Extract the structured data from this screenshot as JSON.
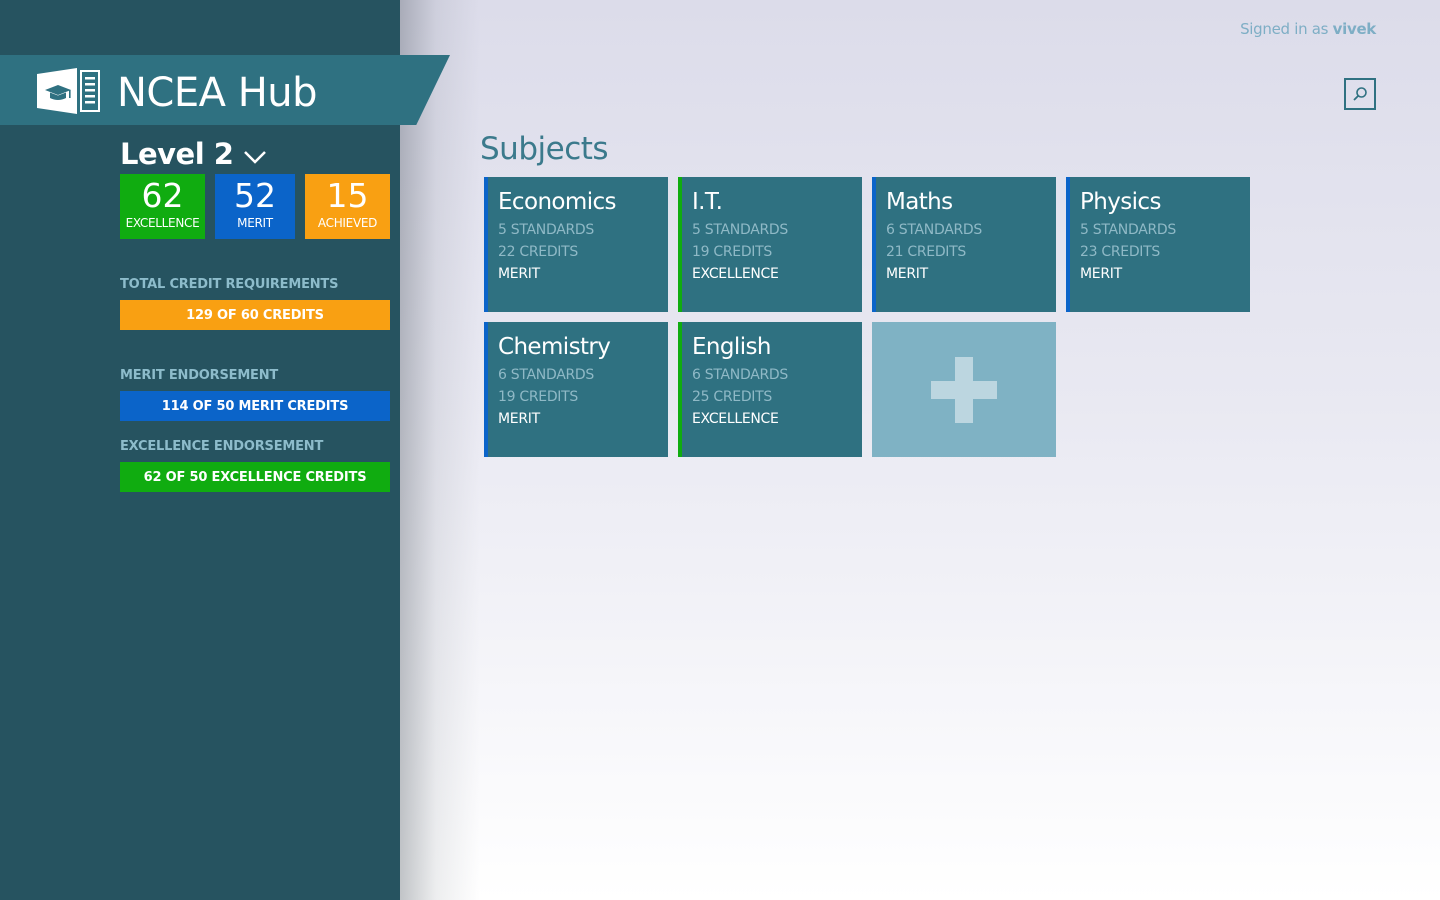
{
  "app": {
    "title": "NCEA Hub"
  },
  "header": {
    "signed_in_prefix": "Signed in as",
    "username": "vivek"
  },
  "level": {
    "label": "Level 2"
  },
  "stats": [
    {
      "value": "62",
      "label": "EXCELLENCE",
      "color": "#10ac10"
    },
    {
      "value": "52",
      "label": "MERIT",
      "color": "#0b64c9"
    },
    {
      "value": "15",
      "label": "ACHIEVED",
      "color": "#f9a012"
    }
  ],
  "requirements": [
    {
      "heading": "TOTAL CREDIT REQUIREMENTS",
      "text": "129 OF 60 CREDITS",
      "color": "#f9a012"
    },
    {
      "heading": "MERIT ENDORSEMENT",
      "text": "114 OF 50 MERIT CREDITS",
      "color": "#0b64c9"
    },
    {
      "heading": "EXCELLENCE ENDORSEMENT",
      "text": "62 OF 50 EXCELLENCE CREDITS",
      "color": "#10ac10"
    }
  ],
  "main": {
    "heading": "Subjects",
    "subjects": [
      {
        "name": "Economics",
        "standards": "5 STANDARDS",
        "credits": "22 CREDITS",
        "grade": "MERIT"
      },
      {
        "name": "I.T.",
        "standards": "5 STANDARDS",
        "credits": "19 CREDITS",
        "grade": "EXCELLENCE"
      },
      {
        "name": "Maths",
        "standards": "6 STANDARDS",
        "credits": "21 CREDITS",
        "grade": "MERIT"
      },
      {
        "name": "Physics",
        "standards": "5 STANDARDS",
        "credits": "23 CREDITS",
        "grade": "MERIT"
      },
      {
        "name": "Chemistry",
        "standards": "6 STANDARDS",
        "credits": "19 CREDITS",
        "grade": "MERIT"
      },
      {
        "name": "English",
        "standards": "6 STANDARDS",
        "credits": "25 CREDITS",
        "grade": "EXCELLENCE"
      }
    ]
  },
  "icons": {
    "logo": "graduation-cap-document-icon",
    "level_dropdown": "chevron-down-icon",
    "search": "search-icon",
    "add": "plus-icon"
  },
  "colors": {
    "sidebar": "#265360",
    "tile": "#2f7181",
    "add_tile": "#7fb2c4",
    "excellence": "#10ac10",
    "merit": "#0b64c9",
    "achieved": "#f9a012"
  }
}
